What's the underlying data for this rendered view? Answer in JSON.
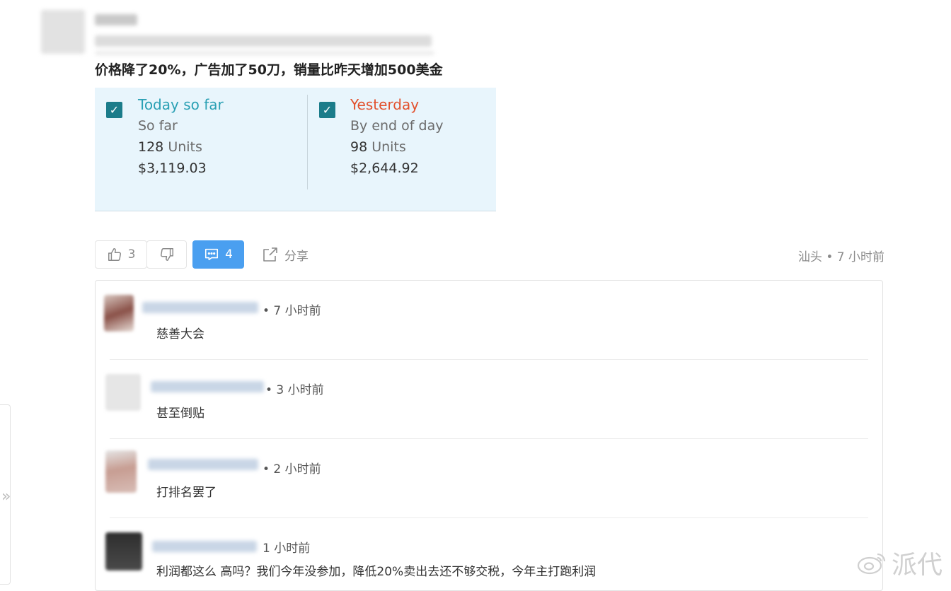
{
  "post": {
    "text": "价格降了20%，广告加了50刀，销量比昨天增加500美金"
  },
  "stats": {
    "today": {
      "title": "Today so far",
      "title_color": "#2aa0b4",
      "subtitle": "So far",
      "units_number": "128",
      "units_label": "Units",
      "amount": "$3,119.03"
    },
    "yesterday": {
      "title": "Yesterday",
      "title_color": "#e2502c",
      "subtitle": "By end of day",
      "units_number": "98",
      "units_label": "Units",
      "amount": "$2,644.92"
    }
  },
  "actions": {
    "like_count": "3",
    "comment_count": "4",
    "share_label": "分享"
  },
  "meta": {
    "location": "汕头",
    "separator": "•",
    "time": "7 小时前"
  },
  "comments": [
    {
      "time": "• 7 小时前",
      "text": "慈善大会"
    },
    {
      "time": "• 3 小时前",
      "text": "甚至倒贴"
    },
    {
      "time": "• 2 小时前",
      "text": "打排名罢了"
    },
    {
      "time": "1 小时前",
      "text": "利润都这么 高吗？我们今年没参加，降低20%卖出去还不够交税，今年主打跑利润"
    }
  ],
  "left_panel": {
    "chevron": "»"
  },
  "watermark": {
    "text": "派代"
  },
  "colors": {
    "accent_blue": "#4a9ff0",
    "checkbox_teal": "#1b7c8a",
    "card_bg": "#e8f5fc"
  }
}
